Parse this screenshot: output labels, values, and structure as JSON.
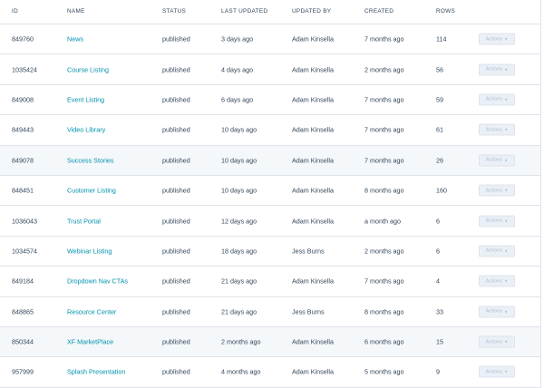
{
  "table": {
    "headers": {
      "id": "ID",
      "name": "NAME",
      "status": "STATUS",
      "last_updated": "LAST UPDATED",
      "updated_by": "UPDATED BY",
      "created": "CREATED",
      "rows": "ROWS"
    },
    "actions_label": "Actions",
    "caret_icon": "chevron-down-icon",
    "rows": [
      {
        "id": "849760",
        "name": "News",
        "status": "published",
        "last_updated": "3 days ago",
        "updated_by": "Adam Kinsella",
        "created": "7 months ago",
        "rows": "114"
      },
      {
        "id": "1035424",
        "name": "Course Listing",
        "status": "published",
        "last_updated": "4 days ago",
        "updated_by": "Adam Kinsella",
        "created": "2 months ago",
        "rows": "56"
      },
      {
        "id": "849008",
        "name": "Event Listing",
        "status": "published",
        "last_updated": "6 days ago",
        "updated_by": "Adam Kinsella",
        "created": "7 months ago",
        "rows": "59"
      },
      {
        "id": "849443",
        "name": "Video Library",
        "status": "published",
        "last_updated": "10 days ago",
        "updated_by": "Adam Kinsella",
        "created": "7 months ago",
        "rows": "61"
      },
      {
        "id": "849078",
        "name": "Success Stories",
        "status": "published",
        "last_updated": "10 days ago",
        "updated_by": "Adam Kinsella",
        "created": "7 months ago",
        "rows": "26"
      },
      {
        "id": "848451",
        "name": "Customer Listing",
        "status": "published",
        "last_updated": "10 days ago",
        "updated_by": "Adam Kinsella",
        "created": "8 months ago",
        "rows": "160"
      },
      {
        "id": "1036043",
        "name": "Trust Portal",
        "status": "published",
        "last_updated": "12 days ago",
        "updated_by": "Adam Kinsella",
        "created": "a month ago",
        "rows": "6"
      },
      {
        "id": "1034574",
        "name": "Webinar Listing",
        "status": "published",
        "last_updated": "18 days ago",
        "updated_by": "Jess Burns",
        "created": "2 months ago",
        "rows": "6"
      },
      {
        "id": "849184",
        "name": "Dropdown Nav CTAs",
        "status": "published",
        "last_updated": "21 days ago",
        "updated_by": "Adam Kinsella",
        "created": "7 months ago",
        "rows": "4"
      },
      {
        "id": "848865",
        "name": "Resource Center",
        "status": "published",
        "last_updated": "21 days ago",
        "updated_by": "Jess Burns",
        "created": "8 months ago",
        "rows": "33"
      },
      {
        "id": "850344",
        "name": "XF MarketPlace",
        "status": "published",
        "last_updated": "2 months ago",
        "updated_by": "Adam Kinsella",
        "created": "6 months ago",
        "rows": "15"
      },
      {
        "id": "957999",
        "name": "Splash Presentation",
        "status": "published",
        "last_updated": "4 months ago",
        "updated_by": "Adam Kinsella",
        "created": "5 months ago",
        "rows": "9"
      }
    ]
  },
  "colors": {
    "link": "#0091ae",
    "text": "#33475b",
    "border": "#dfe3eb",
    "hover_row": "#f5f8fa",
    "button_bg": "#eaf0f6",
    "button_text": "#b0c1d4"
  }
}
